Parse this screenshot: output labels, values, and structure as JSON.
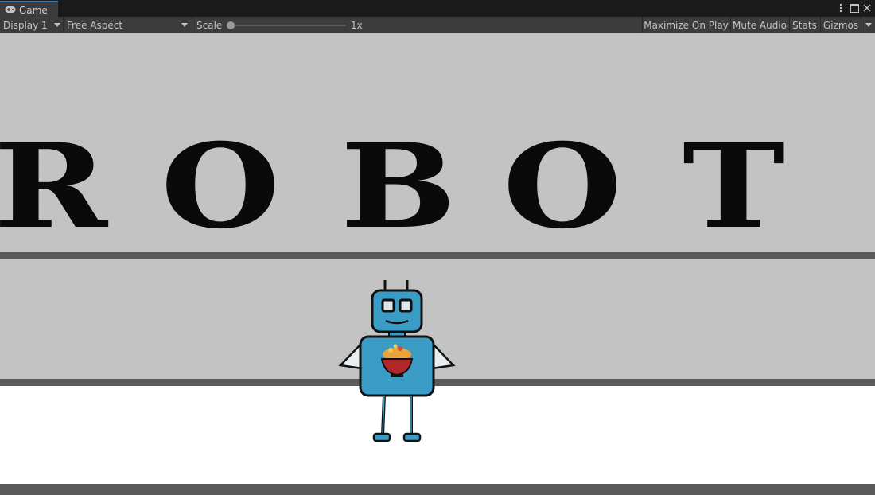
{
  "tab": {
    "title": "Game",
    "icon": "gamepad-icon"
  },
  "window_controls": [
    "more-vertical-icon",
    "maximize-icon",
    "close-icon"
  ],
  "toolbar": {
    "display": "Display 1",
    "aspect": "Free Aspect",
    "scale_label": "Scale",
    "scale_value": "1x",
    "scale_slider_fraction": 0.0,
    "maximize_on_play": "Maximize On Play",
    "mute_audio": "Mute Audio",
    "stats": "Stats",
    "gizmos": "Gizmos"
  },
  "scene": {
    "letters": [
      "R",
      "O",
      "B",
      "O",
      "T"
    ],
    "colors": {
      "background": "#c3c3c3",
      "divider": "#5a5a5a",
      "floor": "#ffffff",
      "robot": "#3a9cc4"
    }
  }
}
